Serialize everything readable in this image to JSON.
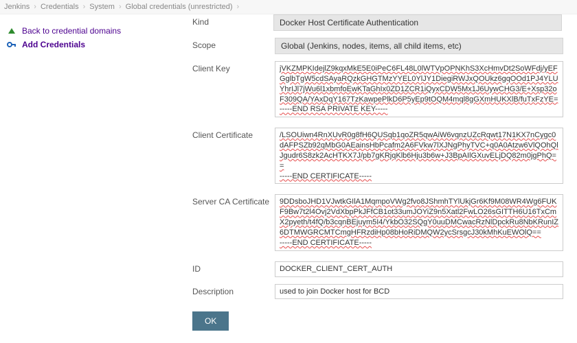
{
  "breadcrumb": {
    "jenkins": "Jenkins",
    "credentials": "Credentials",
    "system": "System",
    "global": "Global credentials (unrestricted)"
  },
  "sidebar": {
    "back": "Back to credential domains",
    "add": "Add Credentials"
  },
  "form": {
    "kind_label": "Kind",
    "kind_value": "Docker Host Certificate Authentication",
    "scope_label": "Scope",
    "scope_value": "Global (Jenkins, nodes, items, all child items, etc)",
    "client_key_label": "Client Key",
    "client_key_value": "jVKZMPKIdejlZ9kqxMkE5E0iPeC6FL48L0lWTVpOPNKhS3XcHmvDt2SoWFdj/yEFGglbTgW5cdSAyaRQzkGHGTMzYYEL0YlJY1DiegiRWJxQOUkz6gqOOd1PJ4YLUYhrIJl7jWu6l1xbmfoEwKTaGhIx0ZD1ZCR1iQyxCDW5Mx1J6UywCHG3/E+Xsp32oF309QA/YAxDqY167TzKawpePlkD6P5yEp9tOQM4mql8gGXmHUKXlB/fuTxFzYE=\n-----END RSA PRIVATE KEY-----",
    "client_cert_label": "Client Certificate",
    "client_cert_value": "/LSOUiwn4RnXUvR0g8fH6QUSqb1qoZR5qwAiW6vqnzUZcRqwt17N1KX7nCygc0dAFPSZb92qMbG0AEainsHbPcafm2A6FVkw7lXJNgPhyTVC+q0A0Atzw6VlQOhQlJgudr6S8zk2AcHTKX7J/pb7gKRjqKlb6Hju3b6w+J3BpAIlGXuvELjDQ82m0jgPhQ==\n-----END CERTIFICATE-----",
    "server_ca_label": "Server CA Certificate",
    "server_ca_value": "9DDsboJHD1VJwtkGIlA1MqmpoVWg2fvo8JShmhTYlUkjGr6Kf9M08WR4Wg6FUKF9Bw7t2l4Ovj2VdXbpPkJFfCB1ot33umJOYiZ9n5Xatl2FwLO26sGITTH6U16TxCmX2pyeth/t4fQ/b3cqnBEjuym5I4/YkbO32SQgY0uuDMCwacRzNlDpckRu8NbKRunIZ6DTMWGRCMTCmgHFRzdiHp08bHoRiDMQW2ycSrsgcJ30kMhKuEWOlQ==\n-----END CERTIFICATE-----",
    "id_label": "ID",
    "id_value": "DOCKER_CLIENT_CERT_AUTH",
    "desc_label": "Description",
    "desc_value": "used to join Docker host for BCD",
    "ok": "OK"
  }
}
